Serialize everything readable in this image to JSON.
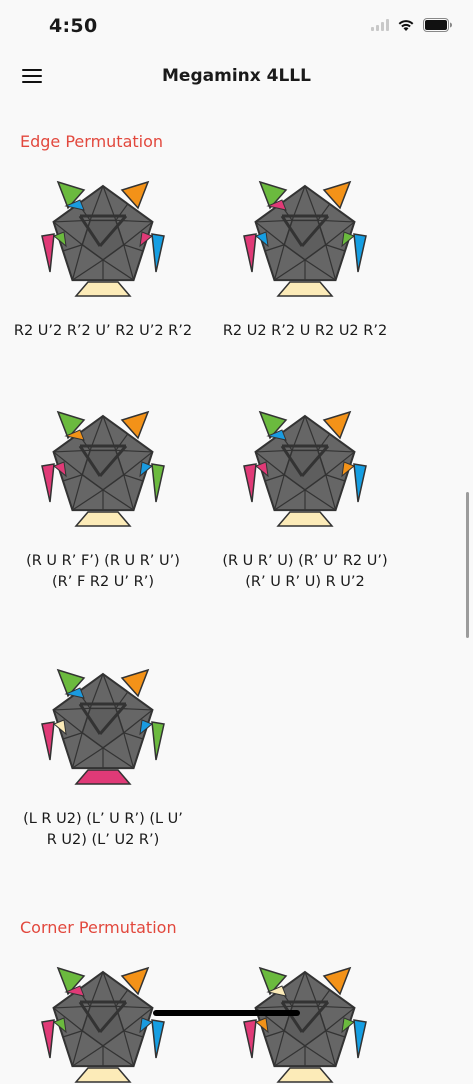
{
  "status": {
    "time": "4:50"
  },
  "header": {
    "title": "Megaminx 4LLL"
  },
  "sections": [
    {
      "title": "Edge Permutation"
    },
    {
      "title": "Corner Permutation"
    }
  ],
  "edge_cases": [
    {
      "alg_line1": "R2 U’2 R’2 U’ R2 U’2 R’2",
      "alg_line2": "",
      "colors": {
        "top_left": "#6bba3e",
        "top_right": "#f39218",
        "left": "#e03a77",
        "right": "#159ee2",
        "bottom": "#fcebb8",
        "edge_tl": "#1a9be0",
        "edge_l": "#6bba3e",
        "edge_r": "#e03a77"
      }
    },
    {
      "alg_line1": "R2 U2 R’2 U R2 U2 R’2",
      "alg_line2": "",
      "colors": {
        "top_left": "#6bba3e",
        "top_right": "#f39218",
        "left": "#e03a77",
        "right": "#159ee2",
        "bottom": "#fcebb8",
        "edge_tl": "#e03a77",
        "edge_l": "#159ee2",
        "edge_r": "#6bba3e"
      }
    },
    {
      "alg_line1": "(R U R’ F’) (R U R’ U’)",
      "alg_line2": "(R’ F R2 U’ R’)",
      "colors": {
        "top_left": "#6bba3e",
        "top_right": "#f39218",
        "left": "#e03a77",
        "right": "#6bba3e",
        "bottom": "#fcebb8",
        "edge_tl": "#f39218",
        "edge_l": "#e03a77",
        "edge_r": "#1a9be0"
      }
    },
    {
      "alg_line1": "(R U R’ U) (R’ U’ R2 U’)",
      "alg_line2": "(R’ U R’ U) R U’2",
      "colors": {
        "top_left": "#6bba3e",
        "top_right": "#f39218",
        "left": "#e03a77",
        "right": "#159ee2",
        "bottom": "#fcebb8",
        "edge_tl": "#1a9be0",
        "edge_l": "#e03a77",
        "edge_r": "#f39218"
      }
    },
    {
      "alg_line1": "(L R U2) (L’ U R’) (L U’",
      "alg_line2": "R U2) (L’ U2 R’)",
      "colors": {
        "top_left": "#6bba3e",
        "top_right": "#f39218",
        "left": "#e03a77",
        "right": "#6bba3e",
        "bottom": "#e03a77",
        "edge_tl": "#1a9be0",
        "edge_l": "#fcebb8",
        "edge_r": "#1a9be0"
      }
    }
  ],
  "corner_cases_partial": [
    {
      "colors": {
        "top_left": "#6bba3e",
        "top_right": "#f39218",
        "left": "#e03a77",
        "right": "#159ee2",
        "bottom": "#fcebb8",
        "edge_tl": "#e03a77",
        "edge_l": "#6bba3e",
        "edge_r": "#1a9be0"
      }
    },
    {
      "colors": {
        "top_left": "#6bba3e",
        "top_right": "#f39218",
        "left": "#e03a77",
        "right": "#159ee2",
        "bottom": "#fcebb8",
        "edge_tl": "#fcebb8",
        "edge_l": "#f39218",
        "edge_r": "#6bba3e"
      }
    }
  ]
}
